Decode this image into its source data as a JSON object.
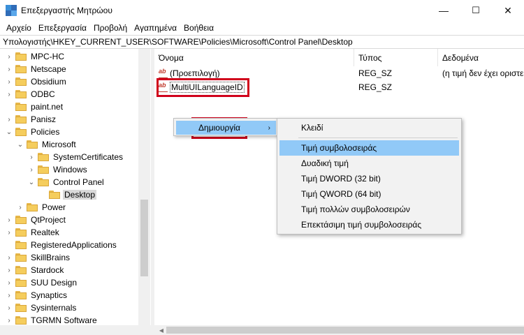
{
  "window": {
    "title": "Επεξεργαστής Μητρώου",
    "minimize": "—",
    "maximize": "☐",
    "close": "✕"
  },
  "menu": [
    "Αρχείο",
    "Επεξεργασία",
    "Προβολή",
    "Αγαπημένα",
    "Βοήθεια"
  ],
  "address": "Υπολογιστής\\HKEY_CURRENT_USER\\SOFTWARE\\Policies\\Microsoft\\Control Panel\\Desktop",
  "tree": [
    {
      "label": "MPC-HC",
      "chev": "›",
      "level": 1
    },
    {
      "label": "Netscape",
      "chev": "›",
      "level": 1
    },
    {
      "label": "Obsidium",
      "chev": "›",
      "level": 1
    },
    {
      "label": "ODBC",
      "chev": "›",
      "level": 1
    },
    {
      "label": "paint.net",
      "chev": "",
      "level": 1
    },
    {
      "label": "Panisz",
      "chev": "›",
      "level": 1
    },
    {
      "label": "Policies",
      "chev": "⌄",
      "level": 1
    },
    {
      "label": "Microsoft",
      "chev": "⌄",
      "level": 2
    },
    {
      "label": "SystemCertificates",
      "chev": "›",
      "level": 3
    },
    {
      "label": "Windows",
      "chev": "›",
      "level": 3
    },
    {
      "label": "Control Panel",
      "chev": "⌄",
      "level": 3
    },
    {
      "label": "Desktop",
      "chev": "",
      "level": 4,
      "selected": true
    },
    {
      "label": "Power",
      "chev": "›",
      "level": 2
    },
    {
      "label": "QtProject",
      "chev": "›",
      "level": 1
    },
    {
      "label": "Realtek",
      "chev": "›",
      "level": 1
    },
    {
      "label": "RegisteredApplications",
      "chev": "",
      "level": 1
    },
    {
      "label": "SkillBrains",
      "chev": "›",
      "level": 1
    },
    {
      "label": "Stardock",
      "chev": "›",
      "level": 1
    },
    {
      "label": "SUU Design",
      "chev": "›",
      "level": 1
    },
    {
      "label": "Synaptics",
      "chev": "›",
      "level": 1
    },
    {
      "label": "Sysinternals",
      "chev": "›",
      "level": 1
    },
    {
      "label": "TGRMN Software",
      "chev": "›",
      "level": 1
    }
  ],
  "list": {
    "headers": [
      "Όνομα",
      "Τύπος",
      "Δεδομένα"
    ],
    "rows": [
      {
        "name": "(Προεπιλογή)",
        "type": "REG_SZ",
        "data": "(η τιμή δεν έχει οριστεί)"
      },
      {
        "name": "MultiUILanguageID",
        "type": "REG_SZ",
        "data": ""
      }
    ]
  },
  "context_menu": {
    "new_label": "Δημιουργία",
    "arrow": "›"
  },
  "submenu": {
    "items": [
      "Κλειδί",
      "Τιμή συμβολοσειράς",
      "Δυαδική τιμή",
      "Τιμή DWORD (32 bit)",
      "Τιμή QWORD (64 bit)",
      "Τιμή πολλών συμβολοσειρών",
      "Επεκτάσιμη τιμή συμβολοσειράς"
    ],
    "highlighted_index": 1
  },
  "colors": {
    "highlight_box": "#d0021b",
    "menu_hover": "#91c9f7"
  }
}
